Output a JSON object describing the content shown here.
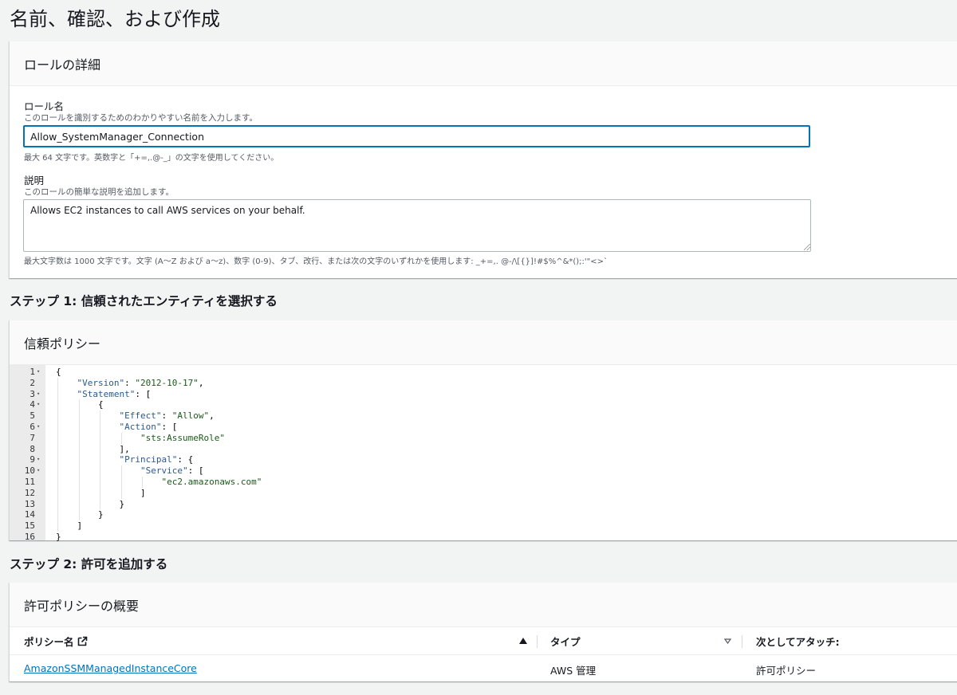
{
  "page": {
    "title": "名前、確認、および作成"
  },
  "role_details": {
    "header": "ロールの詳細",
    "name_label": "ロール名",
    "name_desc": "このロールを識別するためのわかりやすい名前を入力します。",
    "name_value": "Allow_SystemManager_Connection",
    "name_hint": "最大 64 文字です。英数字と「+=,.@-_」の文字を使用してください。",
    "desc_label": "説明",
    "desc_desc": "このロールの簡単な説明を追加します。",
    "desc_value": "Allows EC2 instances to call AWS services on your behalf.",
    "desc_hint": "最大文字数は 1000 文字です。文字 (A〜Z および a〜z)、数字 (0-9)、タブ、改行、または次の文字のいずれかを使用します: _+=,. @-/\\[{}]!#$%^&*();:'\"<>`"
  },
  "step1": {
    "title": "ステップ 1: 信頼されたエンティティを選択する",
    "panel_header": "信頼ポリシー",
    "code_lines": [
      {
        "num": "1",
        "fold": true,
        "html": "{"
      },
      {
        "num": "2",
        "fold": false,
        "indent": 1,
        "key": "\"Version\"",
        "rest": ": ",
        "str": "\"2012-10-17\"",
        "tail": ","
      },
      {
        "num": "3",
        "fold": true,
        "indent": 1,
        "key": "\"Statement\"",
        "rest": ": [",
        "str": "",
        "tail": ""
      },
      {
        "num": "4",
        "fold": true,
        "indent": 2,
        "plain": "{"
      },
      {
        "num": "5",
        "fold": false,
        "indent": 3,
        "key": "\"Effect\"",
        "rest": ": ",
        "str": "\"Allow\"",
        "tail": ","
      },
      {
        "num": "6",
        "fold": true,
        "indent": 3,
        "key": "\"Action\"",
        "rest": ": [",
        "str": "",
        "tail": ""
      },
      {
        "num": "7",
        "fold": false,
        "indent": 4,
        "str": "\"sts:AssumeRole\""
      },
      {
        "num": "8",
        "fold": false,
        "indent": 3,
        "plain": "],"
      },
      {
        "num": "9",
        "fold": true,
        "indent": 3,
        "key": "\"Principal\"",
        "rest": ": {",
        "str": "",
        "tail": ""
      },
      {
        "num": "10",
        "fold": true,
        "indent": 4,
        "key": "\"Service\"",
        "rest": ": [",
        "str": "",
        "tail": ""
      },
      {
        "num": "11",
        "fold": false,
        "indent": 5,
        "str": "\"ec2.amazonaws.com\""
      },
      {
        "num": "12",
        "fold": false,
        "indent": 4,
        "plain": "]"
      },
      {
        "num": "13",
        "fold": false,
        "indent": 3,
        "plain": "}"
      },
      {
        "num": "14",
        "fold": false,
        "indent": 2,
        "plain": "}"
      },
      {
        "num": "15",
        "fold": false,
        "indent": 1,
        "plain": "]"
      },
      {
        "num": "16",
        "fold": false,
        "indent": 0,
        "plain": "}"
      }
    ]
  },
  "step2": {
    "title": "ステップ 2: 許可を追加する",
    "panel_header": "許可ポリシーの概要",
    "columns": {
      "policy_name": "ポリシー名",
      "type": "タイプ",
      "attached_as": "次としてアタッチ:"
    },
    "rows": [
      {
        "policy_name": "AmazonSSMManagedInstanceCore",
        "type": "AWS 管理",
        "attached_as": "許可ポリシー"
      }
    ]
  }
}
